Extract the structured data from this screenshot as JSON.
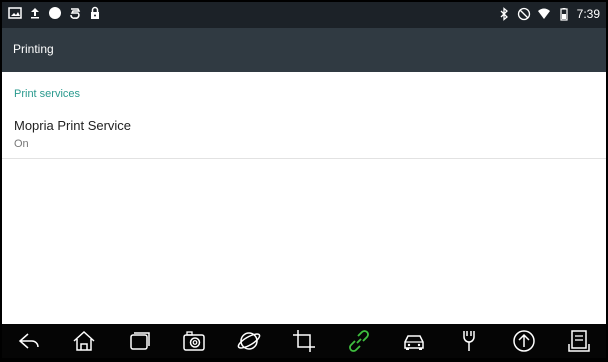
{
  "status_bar": {
    "time": "7:39",
    "left_icons": [
      "image-icon",
      "upload-icon",
      "circle-icon",
      "sync-icon",
      "lock-icon"
    ],
    "right_icons": [
      "bluetooth-icon",
      "do-not-disturb-icon",
      "wifi-icon",
      "battery-icon"
    ]
  },
  "app_bar": {
    "title": "Printing"
  },
  "section": {
    "header": "Print services"
  },
  "services": [
    {
      "name": "Mopria Print Service",
      "status": "On"
    }
  ],
  "nav_bar": {
    "icons": [
      "back-icon",
      "home-icon",
      "recent-apps-icon",
      "camera-icon",
      "browser-icon",
      "crop-icon",
      "link-icon",
      "car-icon",
      "tools-icon",
      "upload-circle-icon",
      "document-icon"
    ],
    "accent_color": "#3fbf3f"
  }
}
